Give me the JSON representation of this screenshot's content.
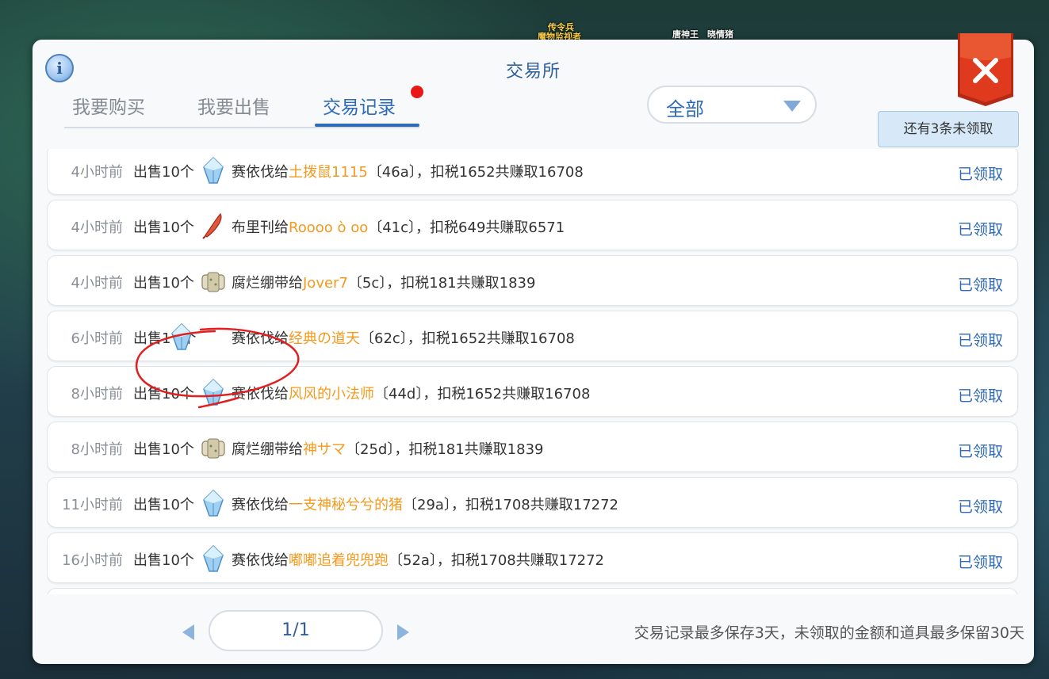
{
  "background": {
    "npc_labels": [
      "传令兵",
      "魔物监视者",
      "唐神王",
      "晓情猪"
    ]
  },
  "dialog": {
    "title": "交易所",
    "info_symbol": "i",
    "tabs": [
      {
        "label": "我要购买",
        "active": false
      },
      {
        "label": "我要出售",
        "active": false
      },
      {
        "label": "交易记录",
        "active": true,
        "has_notification": true
      }
    ],
    "filter": {
      "selected": "全部"
    },
    "unclaimed_badge": "还有3条未领取",
    "records": [
      {
        "time": "4小时前",
        "action": "出售10个",
        "item_icon": "crystal-gem-icon",
        "item": "赛依伐给",
        "buyer": "土拨鼠1115",
        "detail": "〔46a〕，扣税1652共赚取16708",
        "status": "已领取"
      },
      {
        "time": "4小时前",
        "action": "出售10个",
        "item_icon": "red-feather-icon",
        "item": "布里刊给",
        "buyer": "Roooo ò oo",
        "detail": "〔41c〕，扣税649共赚取6571",
        "status": "已领取"
      },
      {
        "time": "4小时前",
        "action": "出售10个",
        "item_icon": "bandage-icon",
        "item": "腐烂绷带给",
        "buyer": "Jover7",
        "detail": "〔5c〕，扣税181共赚取1839",
        "status": "已领取"
      },
      {
        "time": "6小时前",
        "action": "出售1",
        "item_icon": "crystal-gem-icon",
        "item": "赛依伐给",
        "buyer": "经典の道天",
        "detail": "〔62c〕，扣税1652共赚取16708",
        "status": "已领取",
        "action_suffix": "个"
      },
      {
        "time": "8小时前",
        "action": "出售10个",
        "item_icon": "crystal-gem-icon",
        "item": "赛依伐给",
        "buyer": "风风的小法师",
        "detail": "〔44d〕，扣税1652共赚取16708",
        "status": "已领取"
      },
      {
        "time": "8小时前",
        "action": "出售10个",
        "item_icon": "bandage-icon",
        "item": "腐烂绷带给",
        "buyer": "神サマ",
        "detail": "〔25d〕，扣税181共赚取1839",
        "status": "已领取"
      },
      {
        "time": "11小时前",
        "action": "出售10个",
        "item_icon": "crystal-gem-icon",
        "item": "赛依伐给",
        "buyer": "一支神秘兮兮的猪",
        "detail": "〔29a〕，扣税1708共赚取17272",
        "status": "已领取"
      },
      {
        "time": "16小时前",
        "action": "出售10个",
        "item_icon": "crystal-gem-icon",
        "item": "赛依伐给",
        "buyer": "嘟嘟追着兜兜跑",
        "detail": "〔52a〕，扣税1708共赚取17272",
        "status": "已领取"
      }
    ],
    "pagination": {
      "page": "1/1"
    },
    "footer_note": "交易记录最多保存3天，未领取的金额和道具最多保留30天"
  },
  "colors": {
    "accent": "#2f6ab8",
    "buyer_name": "#f39a1e",
    "notification_dot": "#e81818",
    "close_button": "#e03a1e",
    "annotation": "#e02020"
  }
}
